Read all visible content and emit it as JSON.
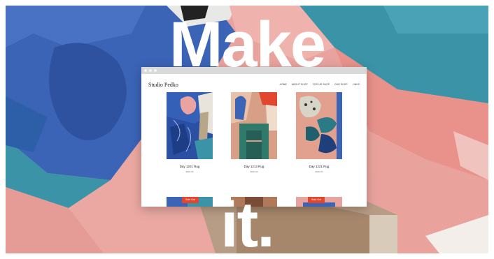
{
  "hero": {
    "line1": "Make",
    "line2": "it."
  },
  "site": {
    "logo": "Studio Pedko",
    "nav": [
      "HOME",
      "ABOUT SHOP",
      "FOR UR SHOP",
      "OUR SHOP",
      "LINKS"
    ]
  },
  "products": [
    {
      "name": "Day 1201 Rug",
      "price": "$000.00"
    },
    {
      "name": "Day 1213 Rug",
      "price": "$000.00"
    },
    {
      "name": "Day 1221 Rug",
      "price": "$000.00"
    }
  ],
  "badges": {
    "left": "Sold Out",
    "right": "Sold Out"
  },
  "colors": {
    "rug_blue": "#3b63b6",
    "rug_pink": "#e9a39e",
    "rug_teal": "#3b93a8",
    "rug_tan": "#b49a80",
    "accent_red": "#e2462f"
  }
}
